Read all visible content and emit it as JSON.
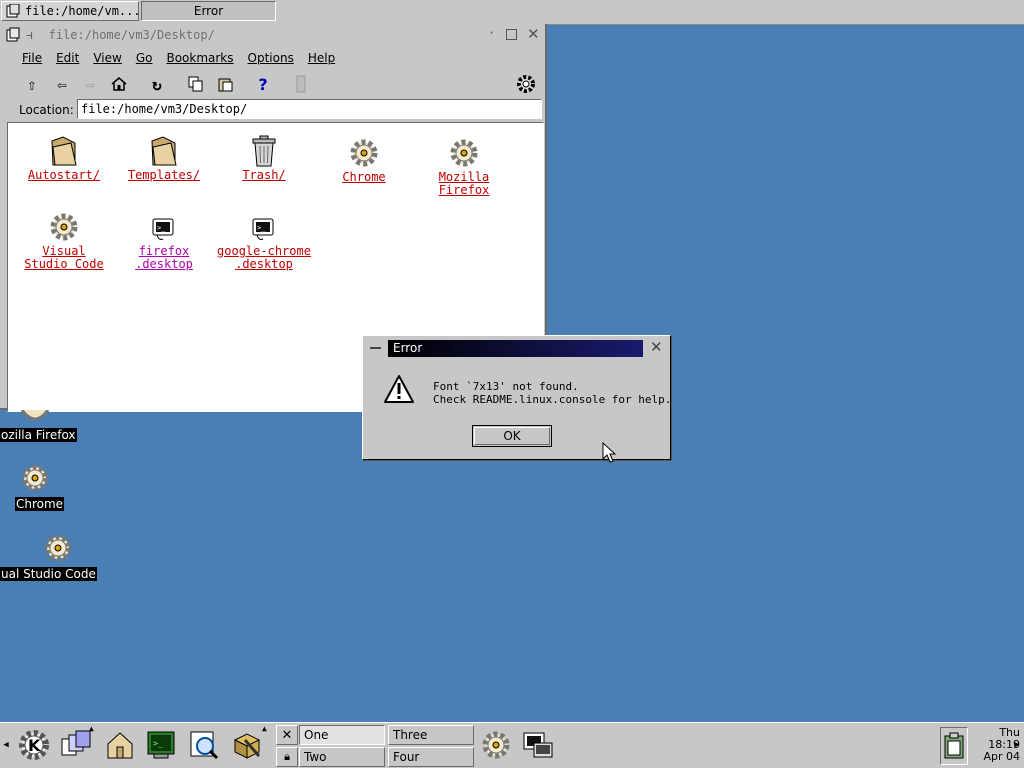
{
  "top_tasks": [
    {
      "label": "file:/home/vm..."
    },
    {
      "label": "Error"
    }
  ],
  "file_manager": {
    "title": "file:/home/vm3/Desktop/",
    "menu": [
      "File",
      "Edit",
      "View",
      "Go",
      "Bookmarks",
      "Options",
      "Help"
    ],
    "location_label": "Location:",
    "location_value": "file:/home/vm3/Desktop/",
    "items": [
      {
        "label": "Autostart/",
        "icon": "folder-icon"
      },
      {
        "label": "Templates/",
        "icon": "folder-icon"
      },
      {
        "label": "Trash/",
        "icon": "trash-icon"
      },
      {
        "label": "Chrome",
        "icon": "gear-icon"
      },
      {
        "label": "Mozilla\nFirefox",
        "icon": "gear-icon"
      },
      {
        "label": "Visual\nStudio Code",
        "icon": "gear-icon"
      },
      {
        "label": "firefox\n.desktop",
        "icon": "terminal-icon"
      },
      {
        "label": "google-chrome\n.desktop",
        "icon": "terminal-icon"
      }
    ]
  },
  "desktop_icons": [
    {
      "label": "ozilla Firefox"
    },
    {
      "label": "Chrome"
    },
    {
      "label": "ual Studio Code"
    }
  ],
  "error_dialog": {
    "title": "Error",
    "message": "Font `7x13' not found.\nCheck README.linux.console for help.",
    "ok_label": "OK"
  },
  "panel": {
    "desktops": [
      "One",
      "Two",
      "Three",
      "Four"
    ],
    "clock": {
      "day": "Thu",
      "time": "18:19",
      "date": "Apr 04"
    }
  },
  "colors": {
    "desktop": "#4a7fb5",
    "link": "#c00000",
    "visited_link": "#b000b0",
    "title_active": "#000000"
  }
}
